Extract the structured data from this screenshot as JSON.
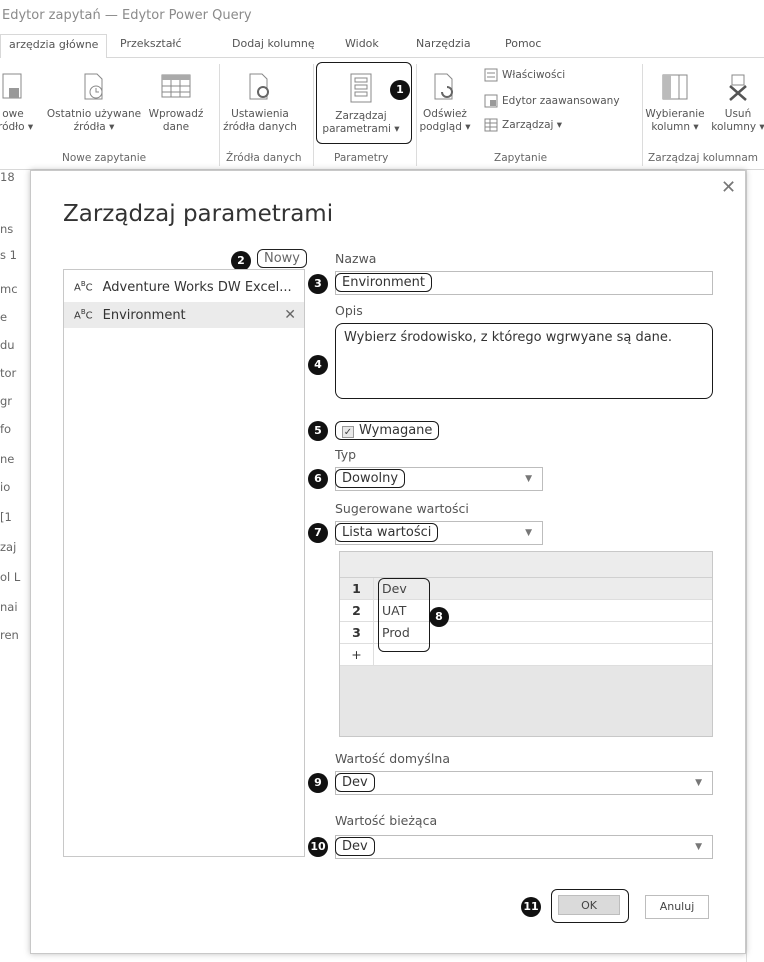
{
  "window": {
    "title": "Edytor zapytań — Edytor Power Query"
  },
  "tabs": [
    "arzędzia główne",
    "Przekształć",
    "Dodaj kolumnę",
    "Widok",
    "Narzędzia",
    "Pomoc"
  ],
  "ribbon": {
    "new_source": "owe\nródło ▾",
    "recent": "Ostatnio używane\nźródła ▾",
    "enter_data": "Wprowadź\ndane",
    "group_new_query": "Nowe zapytanie",
    "source_settings": "Ustawienia\nźródła danych",
    "group_sources": "Źródła danych",
    "manage_params": "Zarządzaj\nparametrami ▾",
    "group_params": "Parametry",
    "refresh": "Odśwież\npodgląd ▾",
    "properties": "Właściwości",
    "advanced_editor": "Edytor zaawansowany",
    "manage": "Zarządzaj ▾",
    "group_query": "Zapytanie",
    "choose_cols": "Wybieranie\nkolumn ▾",
    "remove_cols": "Usuń\nkolumny ▾",
    "group_columns": "Zarządzaj kolumnam"
  },
  "background_left": [
    "18",
    "ns",
    "s 1",
    "mc",
    "e",
    "du",
    "tor",
    "gr",
    "fo",
    "ne",
    "io",
    "[1",
    "zaj",
    "ol L",
    "nai",
    "ren"
  ],
  "dialog": {
    "title": "Zarządzaj parametrami",
    "new_label": "Nowy",
    "params": [
      {
        "type": "ABC",
        "name": "Adventure Works DW Excel..."
      },
      {
        "type": "ABC",
        "name": "Environment"
      }
    ],
    "name_label": "Nazwa",
    "name_value": "Environment",
    "desc_label": "Opis",
    "desc_value": "Wybierz środowisko, z którego wgrwyane są dane.",
    "required_label": "Wymagane",
    "type_label": "Typ",
    "type_value": "Dowolny",
    "suggested_label": "Sugerowane wartości",
    "suggested_value": "Lista wartości",
    "values": [
      {
        "n": "1",
        "v": "Dev"
      },
      {
        "n": "2",
        "v": "UAT"
      },
      {
        "n": "3",
        "v": "Prod"
      }
    ],
    "add_row": "+",
    "default_label": "Wartość domyślna",
    "default_value": "Dev",
    "current_label": "Wartość bieżąca",
    "current_value": "Dev",
    "ok": "OK",
    "cancel": "Anuluj"
  },
  "badges": [
    "1",
    "2",
    "3",
    "4",
    "5",
    "6",
    "7",
    "8",
    "9",
    "10",
    "11"
  ]
}
